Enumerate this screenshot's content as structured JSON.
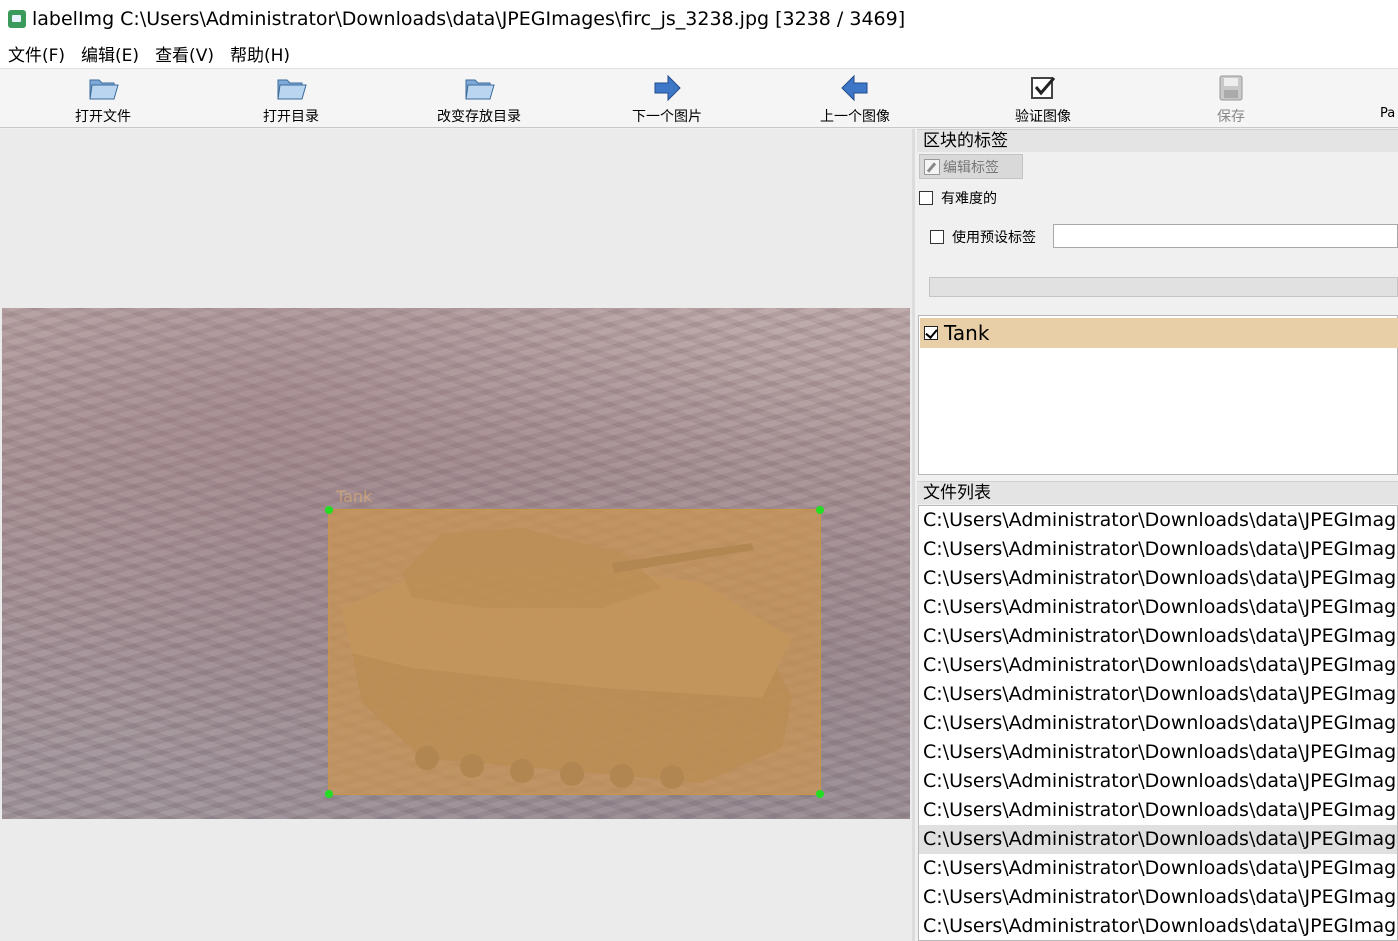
{
  "window": {
    "title": "labelImg C:\\Users\\Administrator\\Downloads\\data\\JPEGImages\\firc_js_3238.jpg [3238 / 3469]"
  },
  "menu": [
    "文件(F)",
    "编辑(E)",
    "查看(V)",
    "帮助(H)"
  ],
  "toolbar": {
    "open_file": "打开文件",
    "open_dir": "打开目录",
    "change_save_dir": "改变存放目录",
    "next_image": "下一个图片",
    "prev_image": "上一个图像",
    "verify_image": "验证图像",
    "save": "保存",
    "partial": "Pa"
  },
  "canvas": {
    "box_label": "Tank"
  },
  "right_panel": {
    "box_labels_title": "区块的标签",
    "edit_label_button": "编辑标签",
    "difficult_checkbox": "有难度的",
    "difficult_checked": false,
    "use_default_label_checkbox": "使用预设标签",
    "use_default_label_checked": false,
    "default_label_value": "",
    "labels": [
      {
        "text": "Tank",
        "checked": true
      }
    ],
    "file_list_title": "文件列表",
    "file_items": [
      "C:\\Users\\Administrator\\Downloads\\data\\JPEGImag",
      "C:\\Users\\Administrator\\Downloads\\data\\JPEGImag",
      "C:\\Users\\Administrator\\Downloads\\data\\JPEGImag",
      "C:\\Users\\Administrator\\Downloads\\data\\JPEGImag",
      "C:\\Users\\Administrator\\Downloads\\data\\JPEGImag",
      "C:\\Users\\Administrator\\Downloads\\data\\JPEGImag",
      "C:\\Users\\Administrator\\Downloads\\data\\JPEGImag",
      "C:\\Users\\Administrator\\Downloads\\data\\JPEGImag",
      "C:\\Users\\Administrator\\Downloads\\data\\JPEGImag",
      "C:\\Users\\Administrator\\Downloads\\data\\JPEGImag",
      "C:\\Users\\Administrator\\Downloads\\data\\JPEGImag",
      "C:\\Users\\Administrator\\Downloads\\data\\JPEGImag",
      "C:\\Users\\Administrator\\Downloads\\data\\JPEGImag",
      "C:\\Users\\Administrator\\Downloads\\data\\JPEGImag",
      "C:\\Users\\Administrator\\Downloads\\data\\JPEGImag"
    ],
    "selected_file_index": 11
  },
  "colors": {
    "box_fill": "#cd9650",
    "handle": "#22dd22",
    "label_row_bg": "#e8cfa8"
  }
}
